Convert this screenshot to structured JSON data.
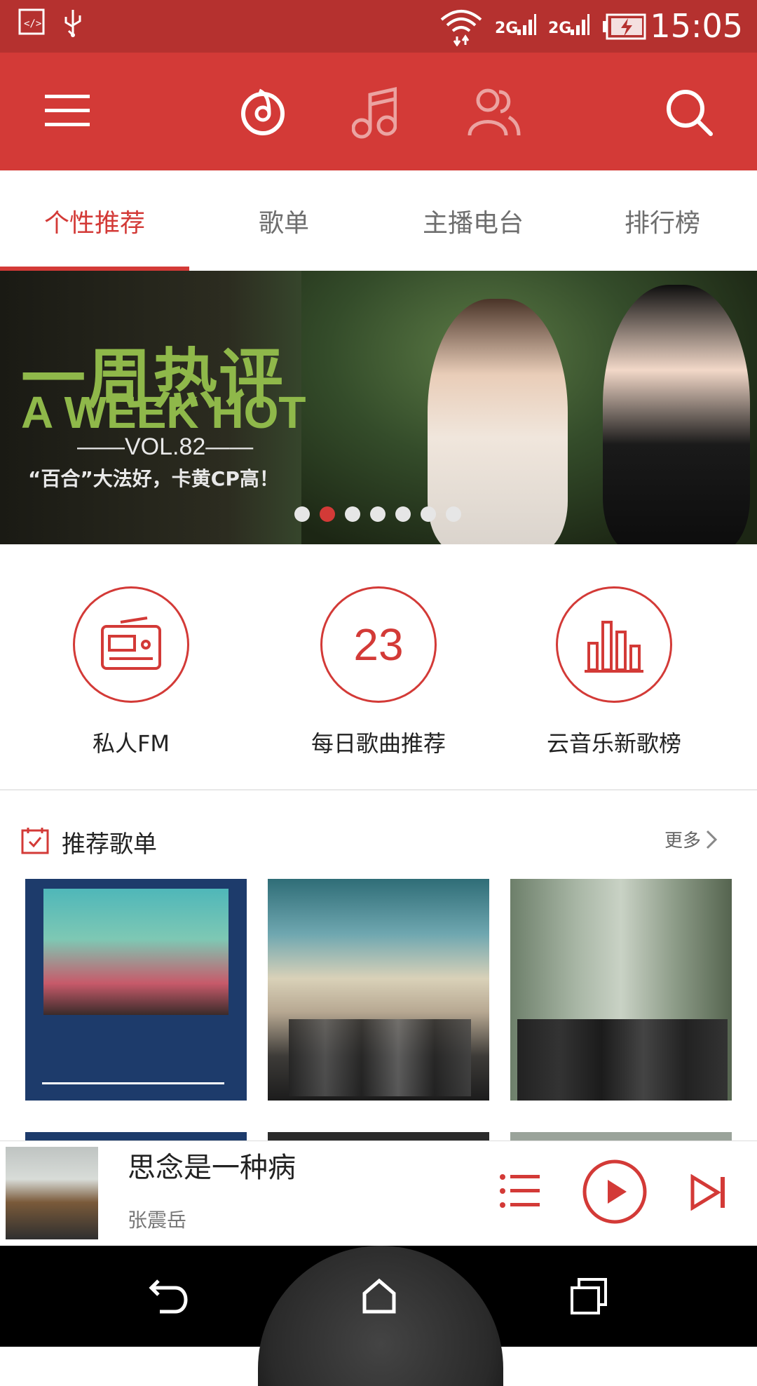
{
  "status_bar": {
    "time": "15:05",
    "net1": "2G",
    "net2": "2G"
  },
  "header": {
    "icons": [
      "menu-icon",
      "netease-music-icon",
      "music-note-icon",
      "friends-icon",
      "search-icon"
    ]
  },
  "tabs": [
    {
      "label": "个性推荐",
      "active": true
    },
    {
      "label": "歌单",
      "active": false
    },
    {
      "label": "主播电台",
      "active": false
    },
    {
      "label": "排行榜",
      "active": false
    }
  ],
  "banner": {
    "title": "一周热评",
    "subtitle": "A WEEK HOT",
    "volume": "——VOL.82——",
    "desc": "“百合”大法好，卡黄CP高！",
    "page_count": 7,
    "active_index": 1
  },
  "quick_entries": [
    {
      "label": "私人FM",
      "icon": "radio-icon"
    },
    {
      "label": "每日歌曲推荐",
      "icon": "calendar-day",
      "number": "23"
    },
    {
      "label": "云音乐新歌榜",
      "icon": "chart-bars-icon"
    }
  ],
  "section": {
    "title": "推荐歌单",
    "more": "更多"
  },
  "player": {
    "song": "思念是一种病",
    "artist": "张震岳"
  },
  "colors": {
    "brand": "#d33a37",
    "status": "#b5312f"
  }
}
